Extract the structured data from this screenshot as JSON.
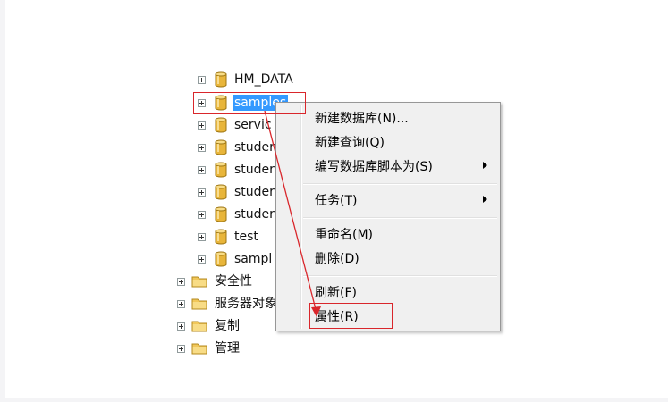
{
  "tree": {
    "databases": [
      {
        "label": "HM_DATA",
        "selected": false
      },
      {
        "label": "samples",
        "selected": true
      },
      {
        "label": "servic",
        "selected": false
      },
      {
        "label": "studer",
        "selected": false
      },
      {
        "label": "studer",
        "selected": false
      },
      {
        "label": "studer",
        "selected": false
      },
      {
        "label": "studer",
        "selected": false
      },
      {
        "label": "test",
        "selected": false
      },
      {
        "label": "sampl",
        "selected": false
      }
    ],
    "folders": [
      {
        "label": "安全性"
      },
      {
        "label": "服务器对象"
      },
      {
        "label": "复制"
      },
      {
        "label": "管理"
      }
    ]
  },
  "context_menu": {
    "items": [
      {
        "label": "新建数据库(N)...",
        "submenu": false
      },
      {
        "label": "新建查询(Q)",
        "submenu": false
      },
      {
        "label": "编写数据库脚本为(S)",
        "submenu": true
      },
      {
        "label": "任务(T)",
        "submenu": true
      },
      {
        "label": "重命名(M)",
        "submenu": false
      },
      {
        "label": "删除(D)",
        "submenu": false
      },
      {
        "label": "刷新(F)",
        "submenu": false
      },
      {
        "label": "属性(R)",
        "submenu": false
      }
    ]
  },
  "colors": {
    "selection": "#3399ff",
    "annotation_red": "#d9262b",
    "db_icon": "#e8b53a",
    "folder_icon": "#f1c75a"
  }
}
